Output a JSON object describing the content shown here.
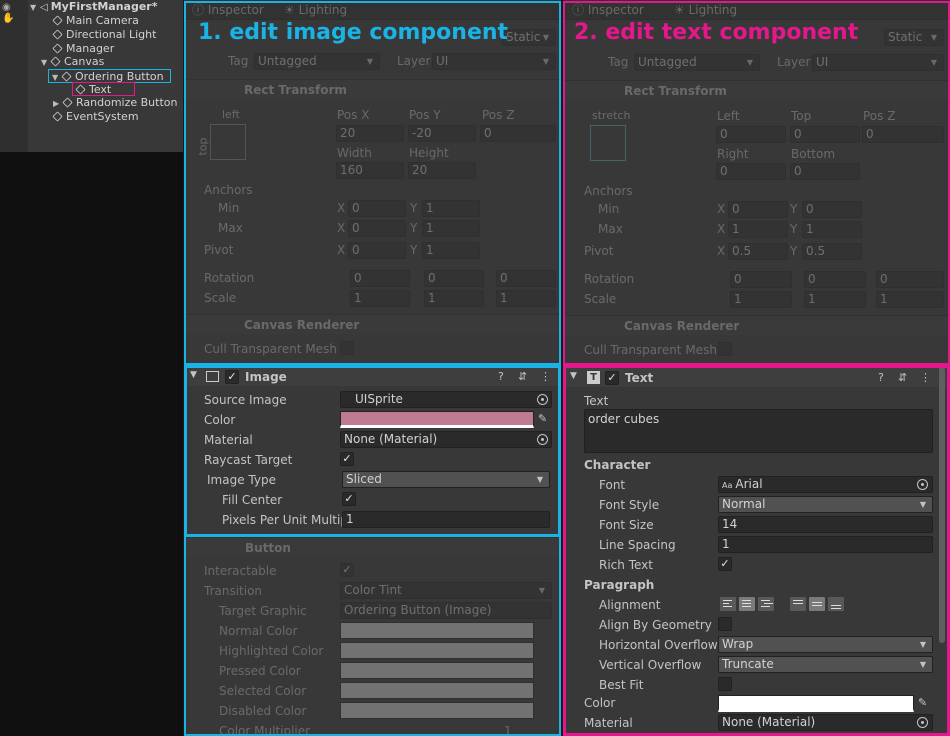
{
  "hierarchy": {
    "scene": "MyFirstManager*",
    "items": [
      {
        "label": "Main Camera"
      },
      {
        "label": "Directional Light"
      },
      {
        "label": "Manager"
      },
      {
        "label": "Canvas"
      },
      {
        "label": "Ordering Button"
      },
      {
        "label": "Text"
      },
      {
        "label": "Randomize Button"
      },
      {
        "label": "EventSystem"
      }
    ]
  },
  "annotations": {
    "left": "1. edit image component",
    "right": "2. edit text component",
    "left_color": "#1ab3e6",
    "right_color": "#e6168c"
  },
  "left_inspector": {
    "tabs": [
      "Inspector",
      "Lighting"
    ],
    "static": "Static",
    "tag_label": "Tag",
    "tag_value": "Untagged",
    "layer_label": "Layer",
    "layer_value": "UI",
    "rect_title": "Rect Transform",
    "anchor_preset_h": "left",
    "anchor_preset_v": "top",
    "pos_headers": [
      "Pos X",
      "Pos Y",
      "Pos Z"
    ],
    "pos_values": [
      "20",
      "-20",
      "0"
    ],
    "size_headers": [
      "Width",
      "Height"
    ],
    "size_values": [
      "160",
      "20"
    ],
    "anchors": "Anchors",
    "min": "Min",
    "max": "Max",
    "min_x": "0",
    "min_y": "1",
    "max_x": "0",
    "max_y": "1",
    "pivot": "Pivot",
    "pivot_x": "0",
    "pivot_y": "1",
    "rotation": "Rotation",
    "rot": [
      "0",
      "0",
      "0"
    ],
    "scale": "Scale",
    "scl": [
      "1",
      "1",
      "1"
    ],
    "canvas_renderer": "Canvas Renderer",
    "cull": "Cull Transparent Mesh",
    "image": {
      "title": "Image",
      "source_image_label": "Source Image",
      "source_image_value": "UISprite",
      "color_label": "Color",
      "color_value": "#c07a90",
      "material_label": "Material",
      "material_value": "None (Material)",
      "raycast_label": "Raycast Target",
      "image_type_label": "Image Type",
      "image_type_value": "Sliced",
      "fill_center_label": "Fill Center",
      "ppu_label": "Pixels Per Unit Multip",
      "ppu_value": "1"
    },
    "button": {
      "title": "Button",
      "interactable": "Interactable",
      "transition_label": "Transition",
      "transition_value": "Color Tint",
      "target_graphic_label": "Target Graphic",
      "target_graphic_value": "Ordering Button (Image)",
      "colors": [
        "Normal Color",
        "Highlighted Color",
        "Pressed Color",
        "Selected Color",
        "Disabled Color"
      ],
      "color_multiplier": "Color Multiplier",
      "color_multiplier_value": "1"
    }
  },
  "right_inspector": {
    "tabs": [
      "Inspector",
      "Lighting"
    ],
    "static": "Static",
    "tag_label": "Tag",
    "tag_value": "Untagged",
    "layer_label": "Layer",
    "layer_value": "UI",
    "rect_title": "Rect Transform",
    "anchor_preset": "stretch",
    "headers1": [
      "Left",
      "Top",
      "Pos Z"
    ],
    "values1": [
      "0",
      "0",
      "0"
    ],
    "headers2": [
      "Right",
      "Bottom"
    ],
    "values2": [
      "0",
      "0"
    ],
    "anchors": "Anchors",
    "min": "Min",
    "max": "Max",
    "min_x": "0",
    "min_y": "0",
    "max_x": "1",
    "max_y": "1",
    "pivot": "Pivot",
    "pivot_x": "0.5",
    "pivot_y": "0.5",
    "rotation": "Rotation",
    "rot": [
      "0",
      "0",
      "0"
    ],
    "scale": "Scale",
    "scl": [
      "1",
      "1",
      "1"
    ],
    "canvas_renderer": "Canvas Renderer",
    "cull": "Cull Transparent Mesh",
    "text": {
      "title": "Text",
      "text_label": "Text",
      "text_value": "order cubes",
      "character": "Character",
      "font_label": "Font",
      "font_value": "Arial",
      "font_style_label": "Font Style",
      "font_style_value": "Normal",
      "font_size_label": "Font Size",
      "font_size_value": "14",
      "line_spacing_label": "Line Spacing",
      "line_spacing_value": "1",
      "rich_text_label": "Rich Text",
      "paragraph": "Paragraph",
      "alignment_label": "Alignment",
      "align_geom_label": "Align By Geometry",
      "h_overflow_label": "Horizontal Overflow",
      "h_overflow_value": "Wrap",
      "v_overflow_label": "Vertical Overflow",
      "v_overflow_value": "Truncate",
      "best_fit_label": "Best Fit",
      "color_label": "Color",
      "color_value": "#ffffff",
      "material_label": "Material",
      "material_value": "None (Material)"
    }
  },
  "axis": {
    "x": "X",
    "y": "Y",
    "z": "Z"
  }
}
